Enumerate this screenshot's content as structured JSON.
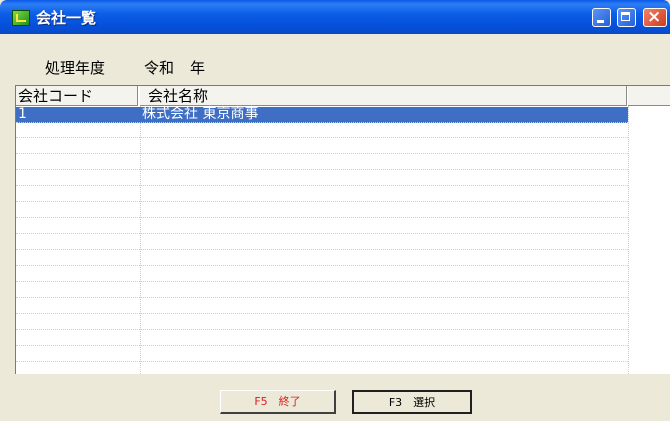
{
  "window": {
    "title": "会社一覧",
    "icon": "app-icon",
    "buttons": [
      "minimize",
      "maximize",
      "close"
    ]
  },
  "header": {
    "year_label": "処理年度",
    "era": "令和",
    "year_suffix": "年"
  },
  "table": {
    "columns": [
      "会社コード",
      "会社名称"
    ],
    "rows": [
      {
        "code": "1",
        "name": "株式会社 東京商事",
        "selected": true
      }
    ]
  },
  "footer": {
    "end_button": "F5　終了",
    "select_button": "F3　選択"
  },
  "colors": {
    "title_bar": "#0550da",
    "selection": "#3f6fc5",
    "end_text": "#d81f1f"
  }
}
